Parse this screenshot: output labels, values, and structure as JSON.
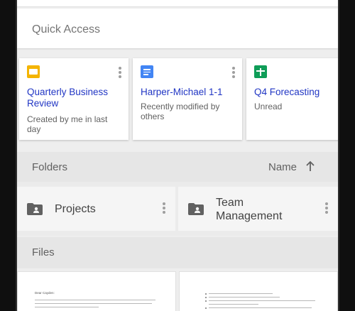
{
  "quick_access": {
    "title": "Quick Access",
    "cards": [
      {
        "title": "Quarterly Business Review",
        "subtitle": "Created by me in last day",
        "icon": "slides-icon",
        "color": "#f4b400"
      },
      {
        "title": "Harper-Michael 1-1",
        "subtitle": "Recently modified by others",
        "icon": "docs-icon",
        "color": "#4285f4"
      },
      {
        "title": "Q4 Forecasting",
        "subtitle": "Unread",
        "icon": "sheets-icon",
        "color": "#0f9d58"
      }
    ]
  },
  "folders": {
    "title": "Folders",
    "sort_label": "Name",
    "sort_icon": "arrow-up-icon",
    "items": [
      {
        "name": "Projects",
        "icon": "shared-folder-icon"
      },
      {
        "name": "Team Management",
        "icon": "shared-folder-icon"
      }
    ]
  },
  "files": {
    "title": "Files",
    "thumbs": [
      {
        "greeting": "Dear Cayden:"
      },
      {
        "bullets": ""
      }
    ]
  },
  "colors": {
    "accent_link": "#2136c4",
    "section_bg": "#e6e6e6"
  }
}
